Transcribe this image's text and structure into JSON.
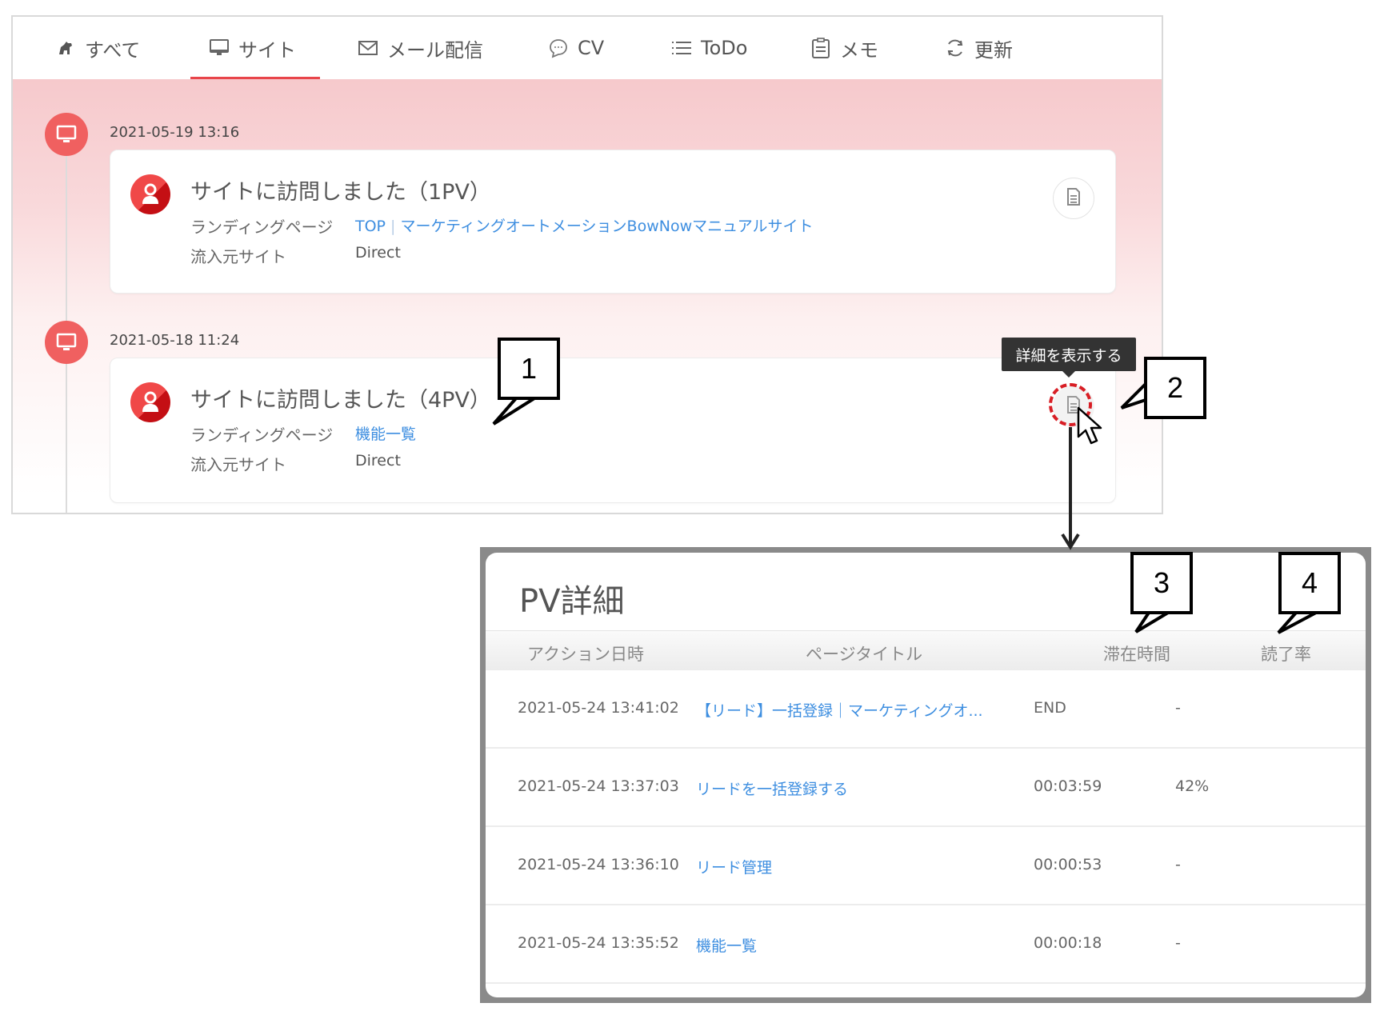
{
  "tabs": [
    {
      "label": "すべて",
      "icon": "dog-icon",
      "active": false
    },
    {
      "label": "サイト",
      "icon": "monitor-icon",
      "active": true
    },
    {
      "label": "メール配信",
      "icon": "mail-icon",
      "active": false
    },
    {
      "label": "CV",
      "icon": "chat-bubble-icon",
      "active": false
    },
    {
      "label": "ToDo",
      "icon": "list-icon",
      "active": false
    },
    {
      "label": "メモ",
      "icon": "clipboard-icon",
      "active": false
    },
    {
      "label": "更新",
      "icon": "refresh-icon",
      "active": false
    }
  ],
  "timeline": [
    {
      "date": "2021-05-19 13:16",
      "title": "サイトに訪問しました（1PV）",
      "landing_label": "ランディングページ",
      "landing_links": [
        "TOP",
        "マーケティングオートメーションBowNowマニュアルサイト"
      ],
      "source_label": "流入元サイト",
      "source_value": "Direct"
    },
    {
      "date": "2021-05-18 11:24",
      "title": "サイトに訪問しました（4PV）",
      "landing_label": "ランディングページ",
      "landing_links": [
        "機能一覧"
      ],
      "source_label": "流入元サイト",
      "source_value": "Direct"
    }
  ],
  "tooltip": "詳細を表示する",
  "pv_detail": {
    "title": "PV詳細",
    "columns": [
      "アクション日時",
      "ページタイトル",
      "滞在時間",
      "読了率"
    ],
    "rows": [
      {
        "datetime": "2021-05-24 13:41:02",
        "page_title": "【リード】一括登録｜マーケティングオ...",
        "stay": "END",
        "read_rate": "-"
      },
      {
        "datetime": "2021-05-24 13:37:03",
        "page_title": "リードを一括登録する",
        "stay": "00:03:59",
        "read_rate": "42%"
      },
      {
        "datetime": "2021-05-24 13:36:10",
        "page_title": "リード管理",
        "stay": "00:00:53",
        "read_rate": "-"
      },
      {
        "datetime": "2021-05-24 13:35:52",
        "page_title": "機能一覧",
        "stay": "00:00:18",
        "read_rate": "-"
      }
    ]
  },
  "callouts": [
    "1",
    "2",
    "3",
    "4"
  ],
  "colors": {
    "accent_red": "#e8454a",
    "link_blue": "#3d8ee0",
    "timeline_dot": "#f06060"
  }
}
